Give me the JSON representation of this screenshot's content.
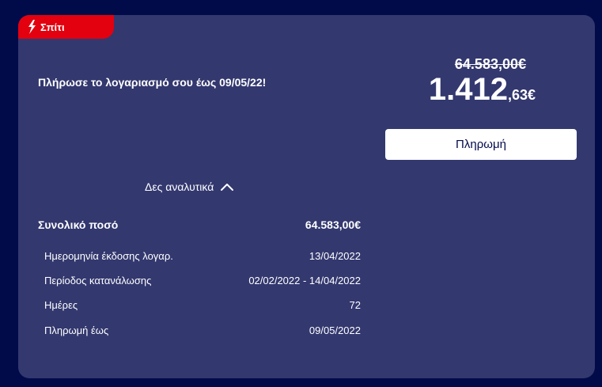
{
  "badge": {
    "label": "Σπίτι"
  },
  "bill": {
    "message": "Πλήρωσε το λογαριασμό σου έως 09/05/22!",
    "old_amount": "64.583,00€",
    "amount_major": "1.412",
    "amount_minor": ",63€",
    "pay_label": "Πληρωμή"
  },
  "details": {
    "toggle_label": "Δες αναλυτικά",
    "total_label": "Συνολικό ποσό",
    "total_value": "64.583,00€",
    "rows": [
      {
        "label": "Ημερομηνία έκδοσης λογαρ.",
        "value": "13/04/2022"
      },
      {
        "label": "Περίοδος κατανάλωσης",
        "value": "02/02/2022 - 14/04/2022"
      },
      {
        "label": "Ημέρες",
        "value": "72"
      },
      {
        "label": "Πληρωμή έως",
        "value": "09/05/2022"
      }
    ]
  },
  "colors": {
    "page_bg": "#020b4a",
    "card_bg": "#33386f",
    "badge_red": "#e3000f",
    "button_bg": "#ffffff",
    "button_text": "#020b4a"
  },
  "icons": {
    "badge_icon": "lightning-bolt-icon",
    "toggle_icon": "chevron-up-icon"
  }
}
